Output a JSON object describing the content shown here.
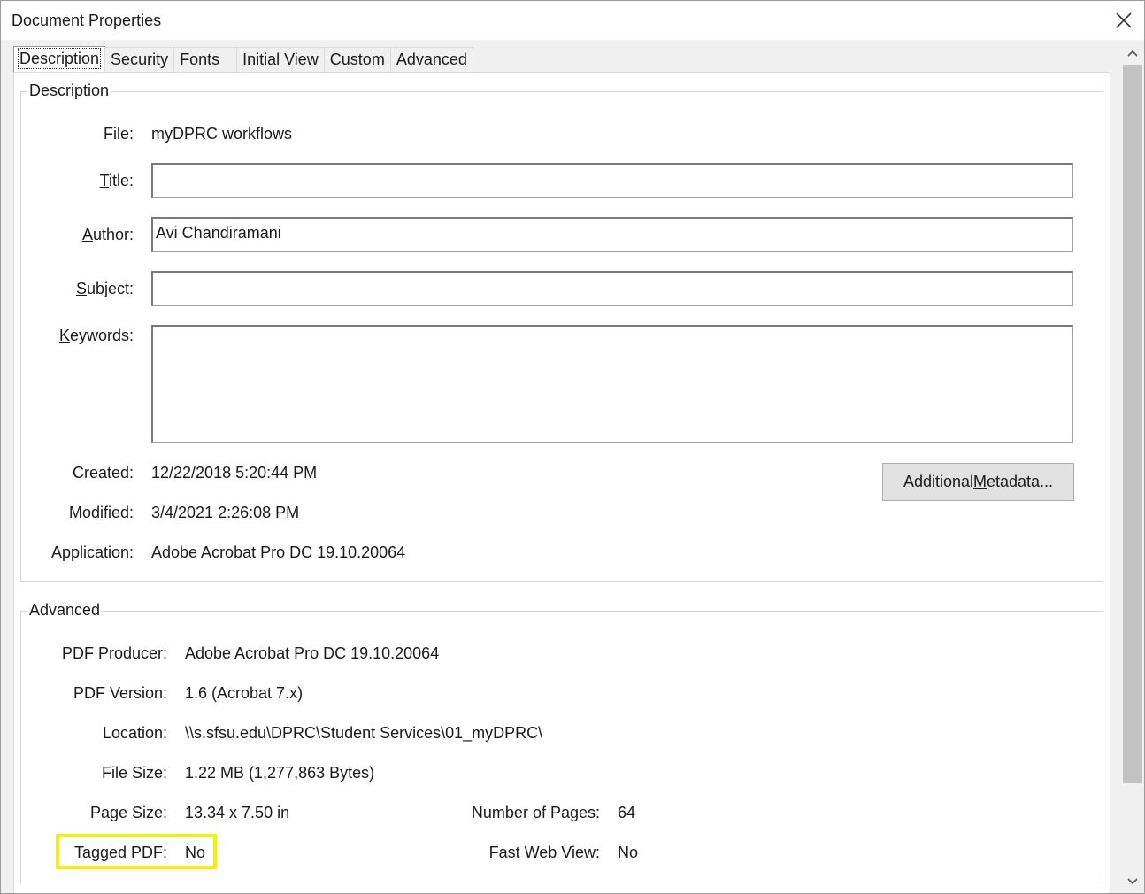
{
  "window": {
    "title": "Document Properties"
  },
  "tabs": [
    {
      "label": "Description",
      "active": true
    },
    {
      "label": "Security",
      "active": false
    },
    {
      "label": "Fonts",
      "active": false
    },
    {
      "label": "Initial View",
      "active": false
    },
    {
      "label": "Custom",
      "active": false
    },
    {
      "label": "Advanced",
      "active": false
    }
  ],
  "description": {
    "legend": "Description",
    "file_label": "File:",
    "file_value": "myDPRC workflows",
    "title_label_accel": "T",
    "title_label_rest": "itle:",
    "title_value": "",
    "author_label_accel": "A",
    "author_label_rest": "uthor:",
    "author_value": "Avi Chandiramani",
    "subject_label_accel": "S",
    "subject_label_rest": "ubject:",
    "subject_value": "",
    "keywords_label_accel": "K",
    "keywords_label_rest": "eywords:",
    "keywords_value": "",
    "created_label": "Created:",
    "created_value": "12/22/2018 5:20:44 PM",
    "modified_label": "Modified:",
    "modified_value": "3/4/2021 2:26:08 PM",
    "application_label": "Application:",
    "application_value": "Adobe Acrobat Pro DC 19.10.20064",
    "metadata_button_pre": "Additional ",
    "metadata_button_accel": "M",
    "metadata_button_post": "etadata..."
  },
  "advanced": {
    "legend": "Advanced",
    "producer_label": "PDF Producer:",
    "producer_value": "Adobe Acrobat Pro DC 19.10.20064",
    "version_label": "PDF Version:",
    "version_value": "1.6 (Acrobat 7.x)",
    "location_label": "Location:",
    "location_value": "\\\\s.sfsu.edu\\DPRC\\Student Services\\01_myDPRC\\",
    "filesize_label": "File Size:",
    "filesize_value": "1.22 MB (1,277,863 Bytes)",
    "pagesize_label": "Page Size:",
    "pagesize_value": "13.34 x 7.50 in",
    "numpages_label": "Number of Pages:",
    "numpages_value": "64",
    "tagged_label": "Tagged PDF:",
    "tagged_value": "No",
    "fastweb_label": "Fast Web View:",
    "fastweb_value": "No"
  },
  "colors": {
    "highlight": "#f2f200",
    "button_bg": "#e1e1e1",
    "scroll_thumb": "#c2c2c2"
  }
}
